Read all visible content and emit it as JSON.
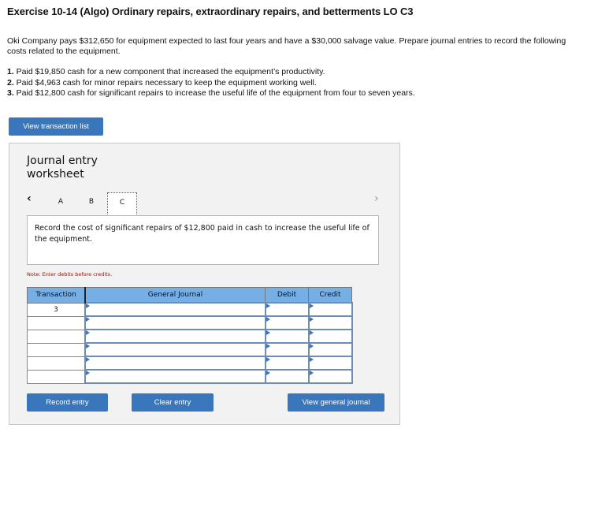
{
  "header": {
    "title": "Exercise 10-14 (Algo) Ordinary repairs, extraordinary repairs, and betterments LO C3"
  },
  "problem": {
    "intro": "Oki Company pays $312,650 for equipment expected to last four years and have a $30,000 salvage value. Prepare journal entries to record the following costs related to the equipment.",
    "items": [
      {
        "num": "1.",
        "text": " Paid $19,850 cash for a new component that increased the equipment’s productivity."
      },
      {
        "num": "2.",
        "text": " Paid $4,963 cash for minor repairs necessary to keep the equipment working well."
      },
      {
        "num": "3.",
        "text": " Paid $12,800 cash for significant repairs to increase the useful life of the equipment from four to seven years."
      }
    ]
  },
  "buttons": {
    "view_transaction_list": "View transaction list",
    "record_entry": "Record entry",
    "clear_entry": "Clear entry",
    "view_general_journal": "View general journal"
  },
  "worksheet": {
    "title_line1": "Journal entry",
    "title_line2": "worksheet",
    "prev_icon": "‹",
    "next_icon": "›",
    "tabs": [
      {
        "label": "A",
        "active": false
      },
      {
        "label": "B",
        "active": false
      },
      {
        "label": "C",
        "active": true
      }
    ],
    "description": "Record the cost of significant repairs of $12,800 paid in cash to increase the useful life of the equipment.",
    "note": "Note: Enter debits before credits."
  },
  "journal_table": {
    "headers": [
      "Transaction",
      "General Journal",
      "Debit",
      "Credit"
    ],
    "rows": [
      {
        "transaction": "3",
        "account": "",
        "debit": "",
        "credit": ""
      },
      {
        "transaction": "",
        "account": "",
        "debit": "",
        "credit": ""
      },
      {
        "transaction": "",
        "account": "",
        "debit": "",
        "credit": ""
      },
      {
        "transaction": "",
        "account": "",
        "debit": "",
        "credit": ""
      },
      {
        "transaction": "",
        "account": "",
        "debit": "",
        "credit": ""
      },
      {
        "transaction": "",
        "account": "",
        "debit": "",
        "credit": ""
      }
    ]
  },
  "colors": {
    "button_blue": "#3a76bb",
    "table_header_blue": "#76aee6",
    "note_red": "#a01010",
    "panel_bg": "#f2f2f2"
  }
}
